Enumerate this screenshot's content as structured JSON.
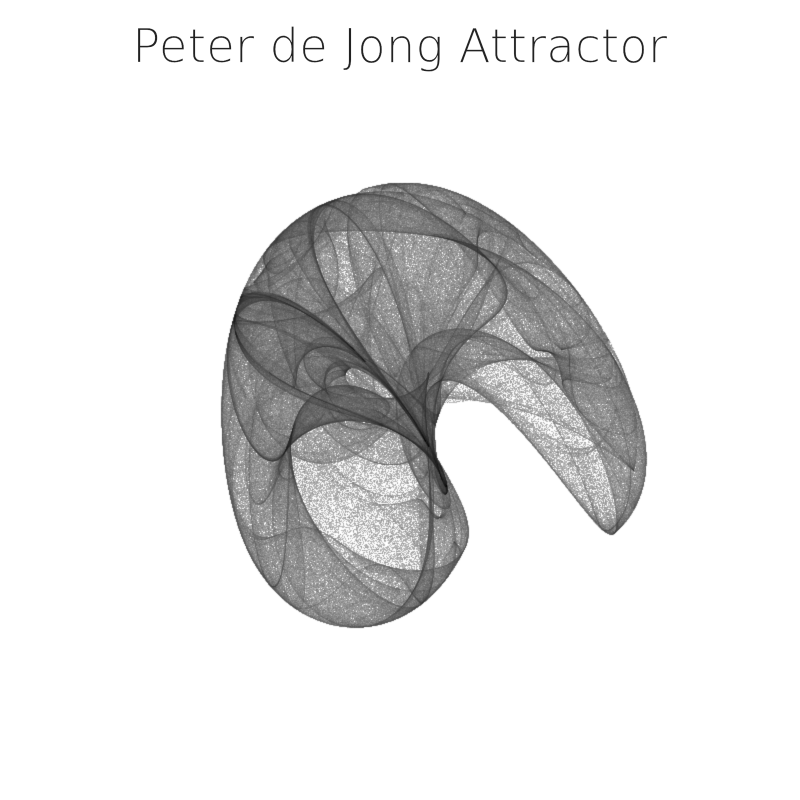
{
  "title": "Peter de Jong Attractor",
  "colors": {
    "background": "#ffffff",
    "ink": "#000000",
    "title_text": "#222222"
  }
}
